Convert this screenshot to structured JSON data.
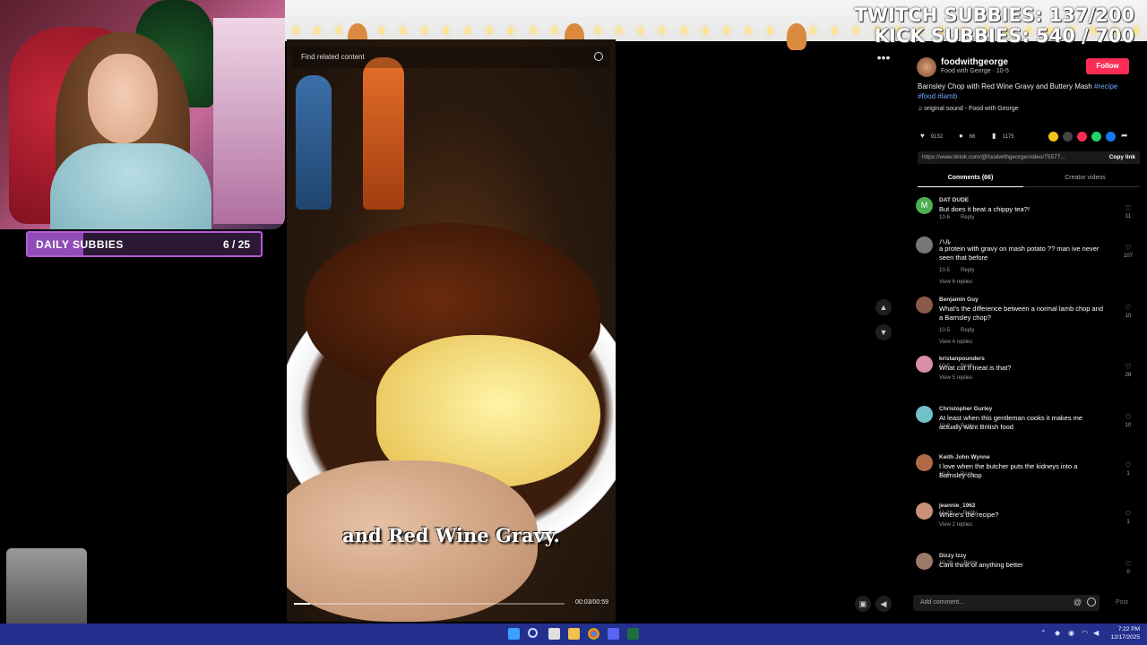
{
  "overlay": {
    "twitch_subbies": "TWITCH SUBBIES: 137/200",
    "kick_subbies": "KICK SUBBIES: 540 / 700",
    "daily_subbies_label": "DAILY SUBBIES",
    "daily_subbies_count": "6 / 25",
    "daily_subbies_progress": 0.24
  },
  "video": {
    "search_placeholder": "Find related content",
    "caption": "and Red Wine Gravy.",
    "time": "00:03/00:59",
    "progress": 0.06
  },
  "post": {
    "author": "foodwithgeorge",
    "author_sub": "Food with George · 10-5",
    "follow_label": "Follow",
    "description": "Barnsley Chop with Red Wine Gravy and Buttery Mash ",
    "tags_inline": "#recipe",
    "tags_line2": "#food #lamb",
    "sound": "original sound - Food with George",
    "likes": "9132",
    "comments_count": "66",
    "saves": "1175",
    "link": "https://www.tiktok.com/@foodwithgeorge/video/75577...",
    "copy_link_label": "Copy link",
    "tab_comments": "Comments (66)",
    "tab_creator": "Creator videos",
    "add_comment_placeholder": "Add comment...",
    "post_label": "Post"
  },
  "comments": [
    {
      "user": "DAT DUDE",
      "text": "But does it beat a chippy tea?!",
      "date": "10-6",
      "reply": "Reply",
      "likes": "11",
      "replies": "",
      "avatar_letter": "M",
      "avatar_color": "#4caf50"
    },
    {
      "user": "ハル",
      "text": "a protein with gravy on mash potato ?? man ive never seen that before",
      "date": "10-5",
      "reply": "Reply",
      "likes": "107",
      "replies": "View 6 replies",
      "avatar_letter": "",
      "avatar_color": "#777777"
    },
    {
      "user": "Benjamin Guy",
      "text": "What's the difference between a normal lamb chop and a Barnsley chop?",
      "date": "10-5",
      "reply": "Reply",
      "likes": "10",
      "replies": "View 4 replies",
      "avatar_letter": "",
      "avatar_color": "#8a5a4a"
    },
    {
      "user": "kristanpounders",
      "text": "What cut if meat is that?",
      "date": "10-5",
      "reply": "Reply",
      "likes": "28",
      "replies": "View 5 replies",
      "avatar_letter": "",
      "avatar_color": "#d98fa8"
    },
    {
      "user": "Christopher Gurley",
      "text": "At least when this gentleman cooks it makes me actually want British food",
      "date": "10-8",
      "reply": "Reply",
      "likes": "10",
      "replies": "",
      "avatar_letter": "",
      "avatar_color": "#6fc3c8"
    },
    {
      "user": "Keith John Wynne",
      "text": "I love when the butcher puts the kidneys into a Barnsley chop",
      "date": "10-6",
      "reply": "Reply",
      "likes": "1",
      "replies": "",
      "avatar_letter": "",
      "avatar_color": "#b06a4a"
    },
    {
      "user": "jeannie_1962",
      "text": "Where's the recipe?",
      "date": "11-26",
      "reply": "Reply",
      "likes": "1",
      "replies": "View 2 replies",
      "avatar_letter": "",
      "avatar_color": "#c9907a"
    },
    {
      "user": "Dizzy Izzy",
      "text": "Cant think of anything better",
      "date": "10-26",
      "reply": "Reply",
      "likes": "0",
      "replies": "",
      "avatar_letter": "",
      "avatar_color": "#9a7a6a"
    }
  ],
  "taskbar": {
    "time": "7:22 PM",
    "date": "12/17/2025"
  },
  "icons": [
    "search-icon",
    "more-icon",
    "chevron-up-icon",
    "chevron-down-icon",
    "volume-icon",
    "heart-icon",
    "comment-icon",
    "bookmark-icon",
    "music-icon",
    "windows-start-icon"
  ]
}
